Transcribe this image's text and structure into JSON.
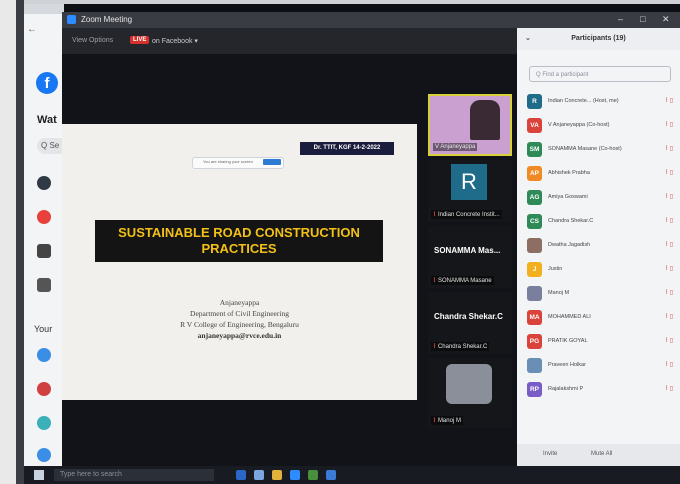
{
  "window": {
    "title": "Zoom Meeting",
    "min": "–",
    "max": "□",
    "close": "✕"
  },
  "browser": {
    "heading": "Wat",
    "search_hint": "Q Se",
    "section": "Your"
  },
  "taskbar": {
    "search_placeholder": "Type here to search"
  },
  "stage": {
    "view_options": "View Options",
    "live_badge": "LIVE",
    "live_on": "on Facebook ▾"
  },
  "slide": {
    "date_label": "Dr. TTIT, KGF 14-2-2022",
    "share_text": "You are sharing your screen",
    "title_line1": "SUSTAINABLE ROAD CONSTRUCTION",
    "title_line2": "PRACTICES",
    "author": "Anjaneyappa",
    "dept": "Department of Civil Engineering",
    "college": "R V College of Engineering, Bengaluru",
    "email": "anjaneyappa@rvce.edu.in"
  },
  "videos": [
    {
      "name": "V Anjaneyappa"
    },
    {
      "initial": "R",
      "name": "Indian Concrete Instit..."
    },
    {
      "big": "SONAMMA Mas...",
      "name": "SONAMMA Masane"
    },
    {
      "big": "Chandra Shekar.C",
      "name": "Chandra Shekar.C"
    },
    {
      "name": "Manoj M"
    }
  ],
  "participants": {
    "title": "Participants (19)",
    "search_placeholder": "Find a participant",
    "items": [
      {
        "initials": "R",
        "color": "#1f6b8a",
        "name": "Indian Concrete... (Host, me)"
      },
      {
        "initials": "VA",
        "color": "#d9433a",
        "name": "V Anjaneyappa (Co-host)"
      },
      {
        "initials": "SM",
        "color": "#2e8b57",
        "name": "SONAMMA Masane (Co-host)"
      },
      {
        "initials": "AP",
        "color": "#f08a24",
        "name": "Abhishek Prabha"
      },
      {
        "initials": "AG",
        "color": "#2e8b57",
        "name": "Amiya Goswami"
      },
      {
        "initials": "CS",
        "color": "#2e8b57",
        "name": "Chandra Shekar.C"
      },
      {
        "initials": "",
        "color": "#8d6e63",
        "name": "Dwatha Jagadish"
      },
      {
        "initials": "J",
        "color": "#f2b01e",
        "name": "Justin"
      },
      {
        "initials": "",
        "color": "#7b7f9e",
        "name": "Manoj M"
      },
      {
        "initials": "MA",
        "color": "#d9433a",
        "name": "MOHAMMED ALI"
      },
      {
        "initials": "PG",
        "color": "#d9433a",
        "name": "PRATIK GOYAL"
      },
      {
        "initials": "",
        "color": "#6a8fb5",
        "name": "Praveen Holkar"
      },
      {
        "initials": "RP",
        "color": "#7a5cc7",
        "name": "Rajalakshmi P"
      }
    ],
    "invite": "Invite",
    "mute_all": "Mute All"
  }
}
